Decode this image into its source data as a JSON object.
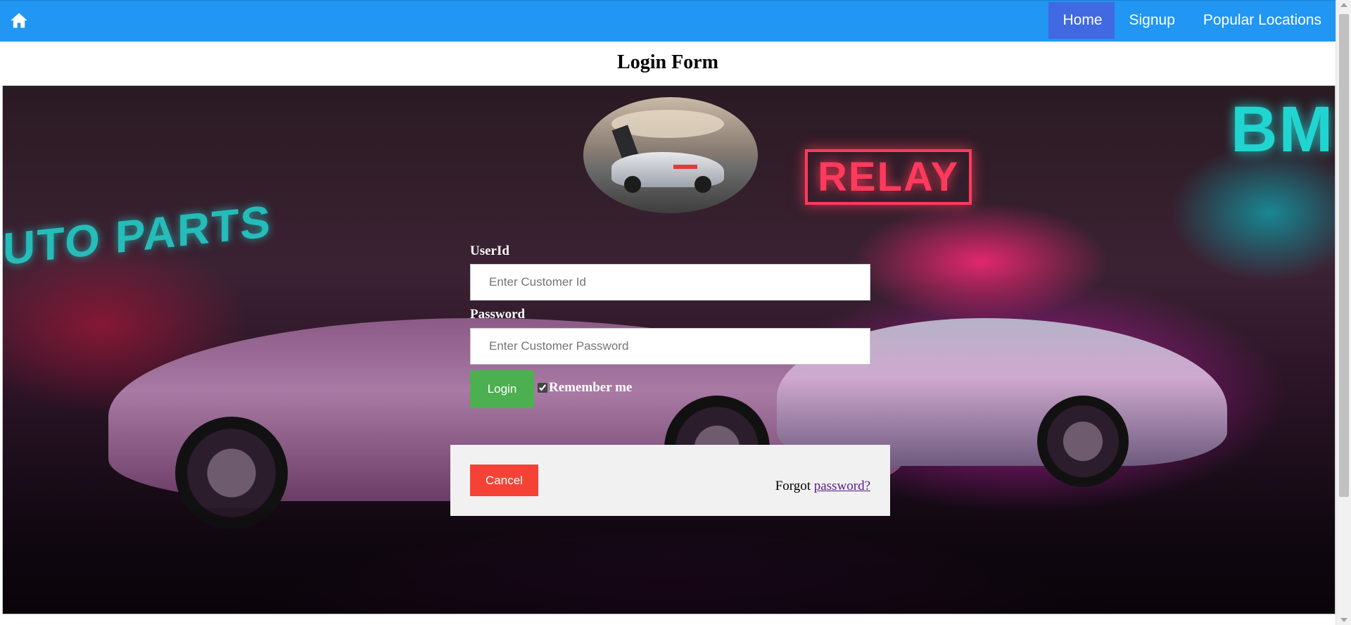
{
  "nav": {
    "home_icon": "home-icon",
    "links": [
      {
        "label": "Home",
        "active": true
      },
      {
        "label": "Signup",
        "active": false
      },
      {
        "label": "Popular Locations",
        "active": false
      }
    ],
    "bar_color": "#2196f3",
    "active_color": "#4169e1"
  },
  "page": {
    "title": "Login Form"
  },
  "background": {
    "neon_left": "UTO PARTS",
    "neon_center": "RELAY",
    "neon_right": "BM"
  },
  "form": {
    "userid_label": "UserId",
    "userid_placeholder": "Enter Customer Id",
    "userid_value": "",
    "password_label": "Password",
    "password_placeholder": "Enter Customer Password",
    "password_value": "",
    "login_label": "Login",
    "remember_label": "Remember me",
    "remember_checked": true,
    "cancel_label": "Cancel",
    "forgot_prefix": "Forgot",
    "forgot_link": "password?",
    "login_color": "#4caf50",
    "cancel_color": "#f44336"
  }
}
